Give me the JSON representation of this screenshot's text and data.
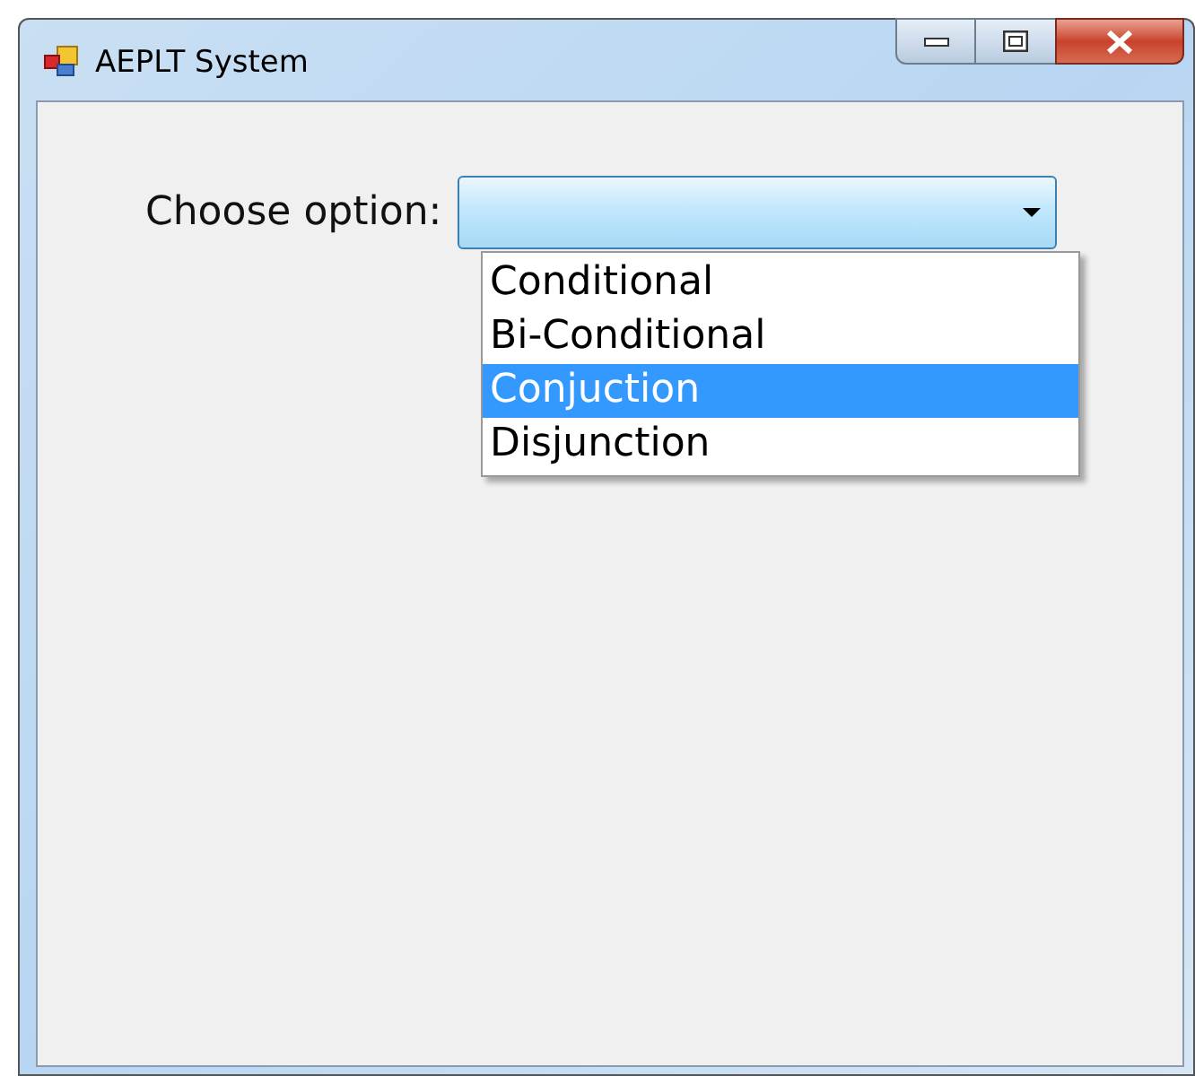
{
  "window": {
    "title": "AEPLT System"
  },
  "form": {
    "label": "Choose option:",
    "dropdown": {
      "expanded": true,
      "options": [
        {
          "label": "Conditional",
          "selected": false
        },
        {
          "label": "Bi-Conditional",
          "selected": false
        },
        {
          "label": "Conjuction",
          "selected": true
        },
        {
          "label": "Disjunction",
          "selected": false
        }
      ]
    }
  }
}
